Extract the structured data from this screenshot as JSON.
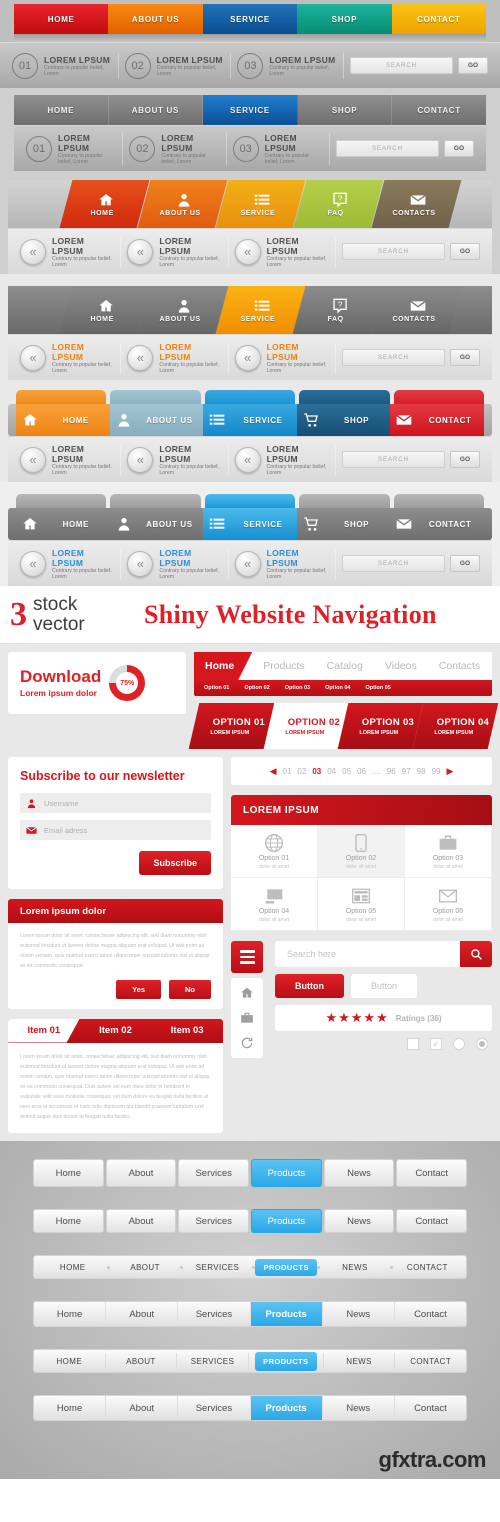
{
  "nav1": {
    "tabs": [
      {
        "label": "HOME",
        "color": "#d81118"
      },
      {
        "label": "ABOUT US",
        "color": "#f07000"
      },
      {
        "label": "SERVICE",
        "color": "#1060a8"
      },
      {
        "label": "SHOP",
        "color": "#12a18a"
      },
      {
        "label": "CONTACT",
        "color": "#f5b300"
      }
    ],
    "info": [
      {
        "num": "01",
        "title": "LOREM LPSUM",
        "sub": "Contrary to popular belief, Lorem"
      },
      {
        "num": "02",
        "title": "LOREM LPSUM",
        "sub": "Contrary to popular belief, Lorem"
      },
      {
        "num": "03",
        "title": "LOREM LPSUM",
        "sub": "Contrary to popular belief, Lorem"
      }
    ],
    "search_placeholder": "SEARCH",
    "go_label": "GO"
  },
  "nav2": {
    "tabs": [
      "HOME",
      "ABOUT US",
      "SERVICE",
      "SHOP",
      "CONTACT"
    ],
    "active": "SERVICE",
    "info": [
      {
        "num": "01",
        "title": "LOREM LPSUM",
        "sub": "Contrary to popular belief, Lorem"
      },
      {
        "num": "02",
        "title": "LOREM LPSUM",
        "sub": "Contrary to popular belief, Lorem"
      },
      {
        "num": "03",
        "title": "LOREM LPSUM",
        "sub": "Contrary to popular belief, Lorem"
      }
    ],
    "search_placeholder": "SEARCH",
    "go_label": "GO"
  },
  "nav3": {
    "tabs": [
      {
        "label": "HOME",
        "icon": "home-icon",
        "color1": "#e8501a",
        "color2": "#cf2a10"
      },
      {
        "label": "ABOUT US",
        "icon": "user-icon",
        "color1": "#f0811b",
        "color2": "#e05c12"
      },
      {
        "label": "SERVICE",
        "icon": "list-icon",
        "color1": "#f2b017",
        "color2": "#e8900f"
      },
      {
        "label": "FAQ",
        "icon": "question-icon",
        "color1": "#b6cf4a",
        "color2": "#9cbb35"
      },
      {
        "label": "CONTACTS",
        "icon": "mail-icon",
        "color1": "#8a7a5c",
        "color2": "#6f6248"
      }
    ],
    "info": [
      {
        "title": "LOREM LPSUM",
        "sub": "Contrary to popular belief, Lorem"
      },
      {
        "title": "LOREM LPSUM",
        "sub": "Contrary to popular belief, Lorem"
      },
      {
        "title": "LOREM LPSUM",
        "sub": "Contrary to popular belief, Lorem"
      }
    ],
    "search_placeholder": "SEARCH",
    "go_label": "GO"
  },
  "nav4": {
    "tabs": [
      {
        "label": "HOME",
        "icon": "home-icon"
      },
      {
        "label": "ABOUT US",
        "icon": "user-icon"
      },
      {
        "label": "SERVICE",
        "icon": "list-icon"
      },
      {
        "label": "FAQ",
        "icon": "question-icon"
      },
      {
        "label": "CONTACTS",
        "icon": "mail-icon"
      }
    ],
    "active": "SERVICE",
    "active_color": "#f5a200",
    "info": [
      {
        "title": "LOREM LPSUM",
        "sub": "Contrary to popular belief, Lorem"
      },
      {
        "title": "LOREM LPSUM",
        "sub": "Contrary to popular belief, Lorem"
      },
      {
        "title": "LOREM LPSUM",
        "sub": "Contrary to popular belief, Lorem"
      }
    ],
    "search_placeholder": "SEARCH",
    "go_label": "GO"
  },
  "nav5": {
    "tabs": [
      {
        "label": "HOME",
        "icon": "home-icon",
        "color": "#f0881c"
      },
      {
        "label": "ABOUT US",
        "icon": "user-icon",
        "color": "#8cb4c4"
      },
      {
        "label": "SERVICE",
        "icon": "list-icon",
        "color": "#1c94d2"
      },
      {
        "label": "SHOP",
        "icon": "cart-icon",
        "color": "#1a5b85"
      },
      {
        "label": "CONTACT",
        "icon": "mail-icon",
        "color": "#d81e28"
      }
    ],
    "info": [
      {
        "title": "LOREM LPSUM",
        "sub": "Contrary to popular belief, Lorem"
      },
      {
        "title": "LOREM LPSUM",
        "sub": "Contrary to popular belief, Lorem"
      },
      {
        "title": "LOREM LPSUM",
        "sub": "Contrary to popular belief, Lorem"
      }
    ],
    "search_placeholder": "SEARCH",
    "go_label": "GO"
  },
  "nav6": {
    "tabs": [
      {
        "label": "HOME",
        "icon": "home-icon"
      },
      {
        "label": "ABOUT US",
        "icon": "user-icon"
      },
      {
        "label": "SERVICE",
        "icon": "list-icon"
      },
      {
        "label": "SHOP",
        "icon": "cart-icon"
      },
      {
        "label": "CONTACT",
        "icon": "mail-icon"
      }
    ],
    "active": "SERVICE",
    "active_color": "#1c9bdb",
    "info": [
      {
        "title": "LOREM LPSUM",
        "sub": "Contrary to popular belief, Lorem"
      },
      {
        "title": "LOREM LPSUM",
        "sub": "Contrary to popular belief, Lorem"
      },
      {
        "title": "LOREM LPSUM",
        "sub": "Contrary to popular belief, Lorem"
      }
    ],
    "search_placeholder": "SEARCH",
    "go_label": "GO"
  },
  "banner": {
    "logo_number": "3",
    "logo_line1": "stock",
    "logo_line2": "vector",
    "title": "Shiny Website Navigation",
    "title_color": "#e02027"
  },
  "download": {
    "title": "Download",
    "subtitle": "Lorem ipsum dolor",
    "percent": "75%"
  },
  "topnav": {
    "items": [
      "Home",
      "Products",
      "Catalog",
      "Videos",
      "Contacts"
    ],
    "active": "Home",
    "suboptions": [
      "Option 01",
      "Option 02",
      "Option 03",
      "Option 04",
      "Option 05"
    ]
  },
  "options_strip": [
    {
      "title": "OPTION 01",
      "sub": "LOREM IPSUM",
      "style": "red"
    },
    {
      "title": "OPTION 02",
      "sub": "LOREM IPSUM",
      "style": "white"
    },
    {
      "title": "OPTION 03",
      "sub": "LOREM IPSUM",
      "style": "red"
    },
    {
      "title": "OPTION 04",
      "sub": "LOREM IPSUM",
      "style": "red"
    }
  ],
  "newsletter": {
    "title": "Subscribe to our newsletter",
    "username_placeholder": "Username",
    "email_placeholder": "Email adress",
    "button_label": "Subscribe"
  },
  "pagination": {
    "prev_icon": "triangle-left-icon",
    "next_icon": "triangle-right-icon",
    "pages": [
      "01",
      "02",
      "03",
      "04",
      "05",
      "06",
      "....",
      "96",
      "97",
      "98",
      "99"
    ],
    "active": "03"
  },
  "lorem_panel": {
    "header": "LOREM IPSUM",
    "cells": [
      {
        "title": "Option 01",
        "sub": "dolor sit amet",
        "icon": "globe-icon",
        "selected": false
      },
      {
        "title": "Option 02",
        "sub": "dolor sit amet",
        "icon": "phone-icon",
        "selected": true
      },
      {
        "title": "Option 03",
        "sub": "dolor sit amet",
        "icon": "briefcase-icon",
        "selected": false
      },
      {
        "title": "Option 04",
        "sub": "dolor sit amet",
        "icon": "monitor-icon",
        "selected": false
      },
      {
        "title": "Option 05",
        "sub": "dolor sit amet",
        "icon": "news-icon",
        "selected": false
      },
      {
        "title": "Option 06",
        "sub": "dolor sit amet",
        "icon": "mail-icon",
        "selected": false
      }
    ]
  },
  "dialog": {
    "header": "Lorem ipsum dolor",
    "body": "Lorem ipsum dolor sit amet, consectetuer adipiscing elit, sed diam nonummy nibh euismod tincidunt ut laoreet dolore magna aliquam erat volutpat. Ut wisi enim ad minim veniam, quis nostrud exerci tation ullamcorper suscipit lobortis nisl ut aliquip ex ea commodo consequat.",
    "yes_label": "Yes",
    "no_label": "No"
  },
  "item_tabs": {
    "tabs": [
      "Item 01",
      "Item 02",
      "Item 03"
    ],
    "active": "Item 01",
    "body": "Lorem ipsum dolor sit amet, consectetuer adipiscing elit, sed diam nonummy nibh euismod tincidunt ut laoreet dolore magna aliquam erat volutpat. Ut wisi enim ad minim veniam, quis nostrud exerci tation ullamcorper suscipit lobortis nisl ut aliquip ex ea commodo consequat. Duis autem vel eum iriure dolor in hendrerit in vulputate velit esse molestie consequat, vel illum dolore eu feugiat nulla facilisis at vero eros et accumsan et iusto odio dignissim qui blandit praesent luptatum zzril delenit augue duis dolore te feugait nulla facilisi."
  },
  "widgets": {
    "menu_icon": "hamburger-icon",
    "side_icons": [
      "home-icon",
      "briefcase-icon",
      "refresh-icon"
    ],
    "search_placeholder": "Search here",
    "search_icon": "search-icon",
    "button_primary": "Button",
    "button_secondary": "Button",
    "stars": "★★★★★",
    "ratings_label": "Ratings (36)",
    "controls": [
      "checkbox-unchecked",
      "checkbox-checked",
      "radio-unchecked",
      "radio-checked"
    ]
  },
  "bottom_bars": [
    {
      "style": "round",
      "items": [
        "Home",
        "About",
        "Services",
        "Products",
        "News",
        "Contact"
      ],
      "active": "Products"
    },
    {
      "style": "round-small",
      "items": [
        "Home",
        "About",
        "Services",
        "Products",
        "News",
        "Contact"
      ],
      "active": "Products"
    },
    {
      "style": "dots",
      "items": [
        "HOME",
        "ABOUT",
        "SERVICES",
        "PRODUCTS",
        "NEWS",
        "CONTACT"
      ],
      "active": "PRODUCTS"
    },
    {
      "style": "flat",
      "items": [
        "Home",
        "About",
        "Services",
        "Products",
        "News",
        "Contact"
      ],
      "active": "Products"
    },
    {
      "style": "sepline",
      "items": [
        "HOME",
        "ABOUT",
        "SERVICES",
        "PRODUCTS",
        "NEWS",
        "CONTACT"
      ],
      "active": "PRODUCTS"
    },
    {
      "style": "flat2",
      "items": [
        "Home",
        "About",
        "Services",
        "Products",
        "News",
        "Contact"
      ],
      "active": "Products"
    }
  ],
  "accent_blue": "#2aa8e8",
  "watermark": "gfxtra.com"
}
